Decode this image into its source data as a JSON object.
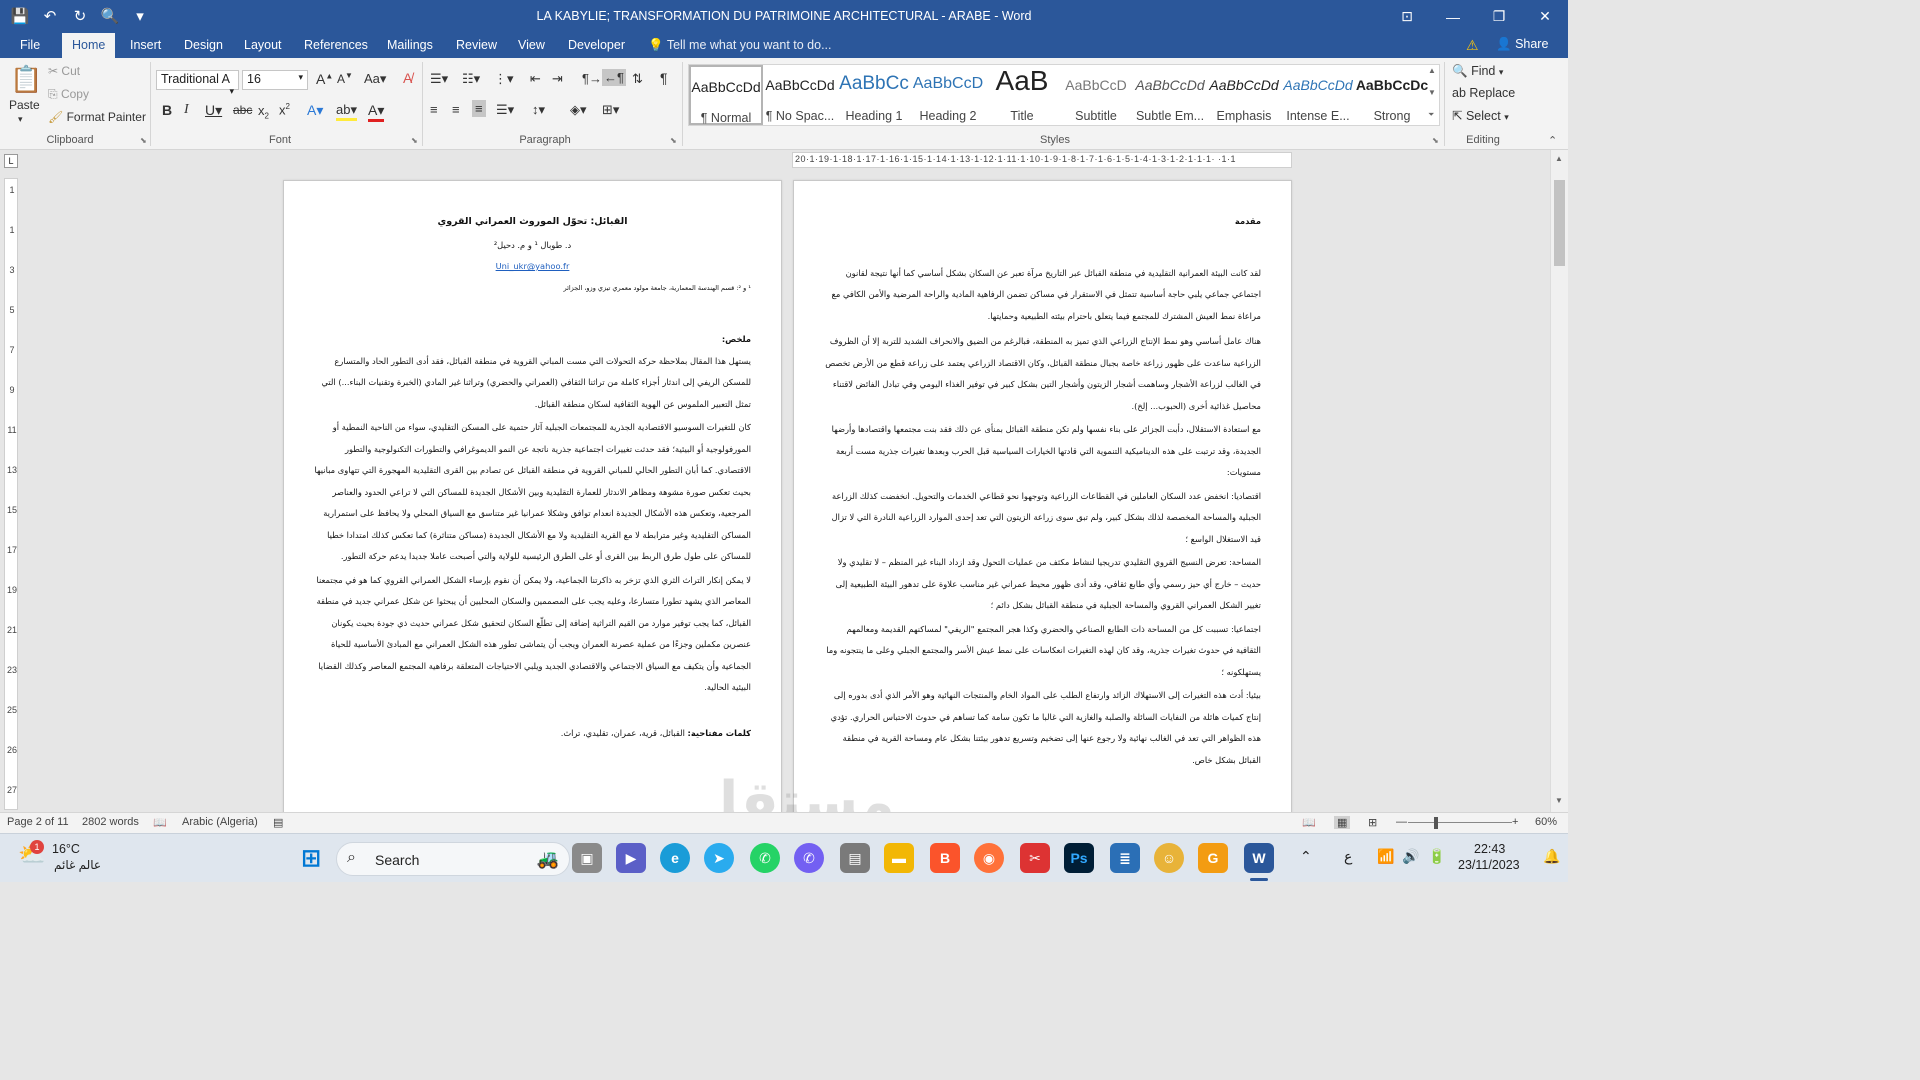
{
  "window": {
    "title": "LA KABYLIE; TRANSFORMATION DU PATRIMOINE ARCHITECTURAL - ARABE - Word",
    "qat_icons": [
      "save-icon",
      "undo-icon",
      "redo-icon",
      "print-preview-icon",
      "customize-qat-icon"
    ]
  },
  "tabs": [
    "File",
    "Home",
    "Insert",
    "Design",
    "Layout",
    "References",
    "Mailings",
    "Review",
    "View",
    "Developer"
  ],
  "active_tab": "Home",
  "tell_me": "Tell me what you want to do...",
  "share": "Share",
  "ribbon": {
    "clipboard": {
      "paste": "Paste",
      "cut": "Cut",
      "copy": "Copy",
      "format_painter": "Format Painter",
      "label": "Clipboard"
    },
    "font": {
      "name": "Traditional A",
      "size": "16",
      "label": "Font"
    },
    "paragraph": {
      "label": "Paragraph"
    },
    "styles": {
      "label": "Styles",
      "items": [
        {
          "preview": "AaBbCcDd",
          "label": "¶ Normal"
        },
        {
          "preview": "AaBbCcDd",
          "label": "¶ No Spac..."
        },
        {
          "preview": "AaBbCc",
          "label": "Heading 1"
        },
        {
          "preview": "AaBbCcD",
          "label": "Heading 2"
        },
        {
          "preview": "AaB",
          "label": "Title"
        },
        {
          "preview": "AaBbCcD",
          "label": "Subtitle"
        },
        {
          "preview": "AaBbCcDd",
          "label": "Subtle Em..."
        },
        {
          "preview": "AaBbCcDd",
          "label": "Emphasis"
        },
        {
          "preview": "AaBbCcDd",
          "label": "Intense E..."
        },
        {
          "preview": "AaBbCcDc",
          "label": "Strong"
        }
      ]
    },
    "editing": {
      "find": "Find",
      "replace": "Replace",
      "select": "Select",
      "label": "Editing"
    }
  },
  "ruler": {
    "numbers": "20·1·19·1·18·1·17·1·16·1·15·1·14·1·13·1·12·1·11·1·10·1·9·1·8·1·7·1·6·1·5·1·4·1·3·1·2·1·1·1· ·1·1"
  },
  "page_left": {
    "title": "القبائل: تحوّل الموروث العمراني القروي",
    "authors": "د. طوبال ¹ و م. دحيل²",
    "email": "Uni_ukr@yahoo.fr",
    "affiliation": "¹ و ²: قسم الهندسة المعمارية، جامعة مولود معمري تيزي وزو، الجزائر",
    "abstract_heading": "ملخص:",
    "paragraphs": [
      "يستهل هذا المقال بملاحظة حركة التحولات التي مست المباني القروية في منطقة القبائل، فقد أدى التطور الحاد والمتسارع للمسكن الريفي إلى اندثار أجزاء كاملة من تراثنا الثقافي (العمراني والحضري) وتراثنا غير المادي (الخبرة وتقنيات البناء...) التي تمثل التعبير الملموس عن الهوية الثقافية لسكان منطقة القبائل.",
      "كان للتغيرات السوسيو الاقتصادية الجذرية للمجتمعات الجبلية آثار حتمية على المسكن التقليدي، سواء من الناحية النمطية أو المورفولوجية أو البيئية؛ فقد حدثت تغييرات اجتماعية جذرية ناتجة عن النمو الديموغرافي والتطورات التكنولوجية والتطور الاقتصادي. كما أبان التطور الحالي للمباني القروية في منطقة القبائل عن تصادم بين القرى التقليدية المهجورة التي تتهاوى مبانيها بحيث تعكس صورة مشوهة ومظاهر الاندثار للعمارة التقليدية وبين الأشكال الجديدة للمساكن التي لا تراعي الحدود والعناصر المرجعية، وتعكس هذه الأشكال الجديدة انعدام توافق وشكلا عمرانيا غير متناسق مع السياق المحلي ولا يحافظ على استمرارية المساكن التقليدية وغير مترابطة لا مع القرية التقليدية ولا مع الأشكال الجديدة (مساكن متناثرة) كما تعكس كذلك امتدادا خطيا للمساكن على طول طرق الربط بين القرى أو على الطرق الرئيسية للولاية والتي أصبحت عاملا جديدا يدعم حركة التطور.",
      "لا يمكن إنكار التراث الثري الذي تزخر به ذاكرتنا الجماعية، ولا يمكن أن نقوم بإرساء الشكل العمراني القروي كما هو في مجتمعنا المعاصر الذي يشهد تطورا متسارعا، وعليه يجب على المصممين والسكان المحليين أن يبحثوا عن شكل عمراني جديد في منطقة القبائل، كما يجب توفير موارد من القيم التراثية إضافة إلى تطلّع السكان لتحقيق شكل عمراني حديث ذي جودة بحيث يكونان عنصرين مكملين وجزءًا من عملية عصرنة العمران ويجب أن يتماشى تطور هذه الشكل العمراني مع المبادئ الأساسية للحياة الجماعية وأن يتكيف مع السياق الاجتماعي والاقتصادي الجديد ويلبي الاحتياجات المتعلقة برفاهية المجتمع المعاصر وكذلك القضايا البيئية الحالية."
    ],
    "keywords_label": "كلمات مفتاحية:",
    "keywords": "القبائل، قرية، عمران، تقليدي، تراث."
  },
  "page_right": {
    "heading": "مقدمة",
    "paragraphs": [
      "لقد كانت البيئة العمرانية التقليدية في منطقة القبائل عبر التاريخ مرآة تعبر عن السكان بشكل أساسي كما أنها نتيجة لقانون اجتماعي جماعي يلبي حاجة أساسية تتمثل في الاستقرار في مساكن تضمن الرفاهية المادية والراحة المرضية والأمن الكافي مع مراعاة نمط العيش المشترك للمجتمع فيما يتعلق باحترام بيئته الطبيعية وحمايتها.",
      "هناك عامل أساسي وهو نمط الإنتاج الزراعي الذي تميز به المنطقة، فبالرغم من الضيق والانحراف الشديد للتربة إلا أن الظروف الزراعية ساعدت على ظهور زراعة خاصة بجبال منطقة القبائل، وكان الاقتصاد الزراعي يعتمد على زراعة قطع من الأرض تخصص في الغالب لزراعة الأشجار وساهمت أشجار الزيتون وأشجار التين بشكل كبير في توفير الغذاء اليومي وفي تبادل الفائض لاقتناء محاصيل غذائية أخرى (الحبوب... إلخ).",
      "مع استعادة الاستقلال، دأبت الجزائر على بناء نفسها ولم تكن منطقة القبائل بمنأى عن ذلك فقد بنت مجتمعها واقتصادها وأرضها الجديدة، وقد ترتبت على هذه الديناميكية التنموية التي قادتها الخيارات السياسية قبل الحرب وبعدها تغيرات جذرية مست أربعة مستويات:",
      "اقتصاديا: انخفض عدد السكان العاملين في القطاعات الزراعية وتوجهوا نحو قطاعي الخدمات والتحويل. انخفضت كذلك الزراعة الجبلية والمساحة المخصصة لذلك بشكل كبير، ولم تبق سوى زراعة الزيتون التي تعد إحدى الموارد الزراعية النادرة التي لا تزال قيد الاستغلال الواسع ؛",
      "المساحة: تعرض النسيج القروي التقليدي تدريجيا لنشاط مكثف من عمليات التحول وقد ازداد البناء غير المنظم – لا تقليدي ولا حديث – خارج أي حيز رسمي وأي طابع ثقافي، وقد أدى ظهور محيط عمراني غير مناسب علاوة على تدهور البيئة الطبيعية إلى تغيير الشكل العمراني القروي والمساحة الجبلية في منطقة القبائل بشكل دائم ؛",
      "اجتماعيا: تسببت كل من المساحة ذات الطابع الصناعي والحضري وكذا هجر المجتمع \"الريفي\" لمساكنهم القديمة ومعالمهم الثقافية في حدوث تغيرات جذرية، وقد كان لهذه التغيرات انعكاسات على نمط عيش الأسر والمجتمع الجبلي وعلى ما ينتجونه وما يستهلكونه ؛",
      "بيئيا: أدت هذه التغيرات إلى الاستهلاك الزائد وارتفاع الطلب على المواد الخام والمنتجات النهائية وهو الأمر الذي أدى بدوره إلى إنتاج كميات هائلة من النفايات السائلة والصلبة والغازية التي غالبا ما تكون سامة كما تساهم في حدوث الاحتباس الحراري. تؤدي هذه الظواهر التي تعد في الغالب نهائية ولا رجوع عنها إلى تضخيم وتسريع تدهور بيئتنا بشكل عام ومساحة القرية في منطقة القبائل بشكل خاص."
    ]
  },
  "status": {
    "page": "Page 2 of 11",
    "words": "2802 words",
    "language": "Arabic (Algeria)",
    "zoom": "60%"
  },
  "taskbar": {
    "weather_temp": "16°C",
    "weather_text": "عالم غائم",
    "search": "Search",
    "time": "22:43",
    "date": "23/11/2023",
    "lang": "ع"
  },
  "watermark": "مستقل"
}
